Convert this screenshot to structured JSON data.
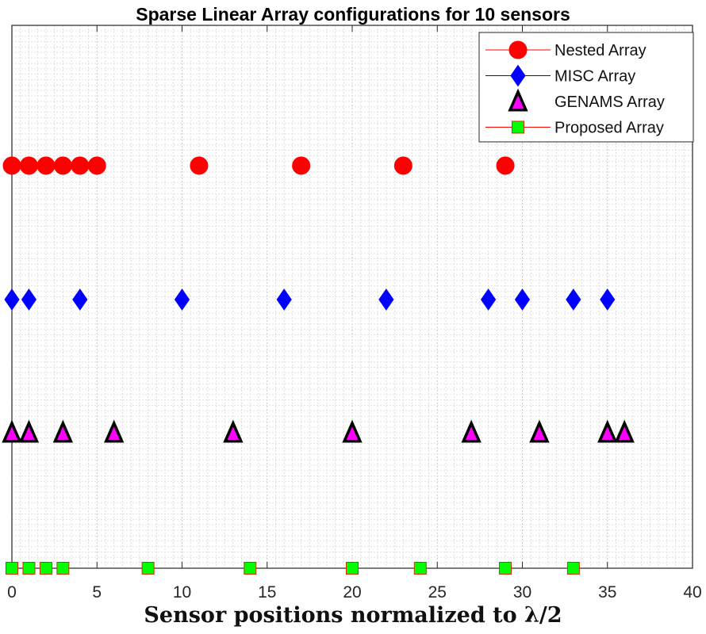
{
  "chart_data": {
    "type": "scatter",
    "title": "Sparse Linear Array configurations for 10 sensors",
    "xlabel": "Sensor positions normalized to λ/2",
    "ylabel": "",
    "xlim": [
      0,
      40
    ],
    "ylim": [
      0,
      4
    ],
    "xticks": [
      "0",
      "5",
      "10",
      "15",
      "20",
      "25",
      "30",
      "35",
      "40"
    ],
    "xtick_values": [
      0,
      5,
      10,
      15,
      20,
      25,
      30,
      35,
      40
    ],
    "grid": "on (major and minor, dotted)",
    "legend_position": "top-right",
    "series": [
      {
        "name": "Nested Array",
        "marker": "circle",
        "color": "#ff0000",
        "edge": "#ff0000",
        "line": "#ff0000",
        "y": 4,
        "x": [
          0,
          1,
          2,
          3,
          4,
          5,
          11,
          17,
          23,
          29
        ]
      },
      {
        "name": "MISC Array",
        "marker": "diamond",
        "color": "#0000ff",
        "edge": "#0000ff",
        "line": "#0000ff",
        "y": 3,
        "x": [
          0,
          1,
          4,
          10,
          16,
          22,
          28,
          30,
          33,
          35
        ]
      },
      {
        "name": "GENAMS Array",
        "marker": "triangle",
        "color": "#ff00ff",
        "edge": "#000000",
        "line": "none",
        "y": 2,
        "x": [
          0,
          1,
          3,
          6,
          13,
          20,
          27,
          31,
          35,
          36
        ]
      },
      {
        "name": "Proposed Array",
        "marker": "square",
        "color": "#00ff00",
        "edge": "#cc3300",
        "line": "#ff0000",
        "y": 1,
        "x": [
          0,
          1,
          2,
          3,
          8,
          14,
          20,
          24,
          29,
          33
        ]
      }
    ]
  }
}
